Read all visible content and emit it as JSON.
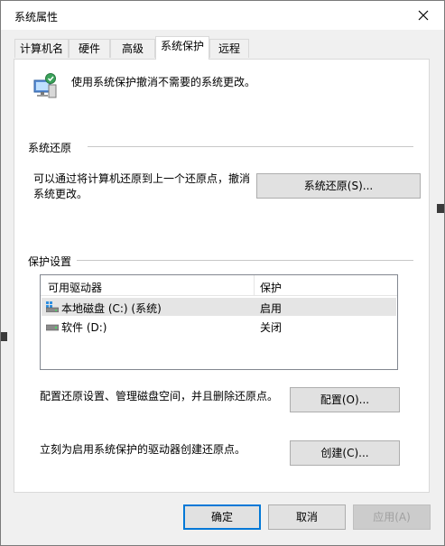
{
  "window": {
    "title": "系统属性"
  },
  "tabs": [
    {
      "label": "计算机名"
    },
    {
      "label": "硬件"
    },
    {
      "label": "高级"
    },
    {
      "label": "系统保护"
    },
    {
      "label": "远程"
    }
  ],
  "active_tab": "系统保护",
  "header": {
    "description": "使用系统保护撤消不需要的系统更改。",
    "icon": "system-protection-icon"
  },
  "restore": {
    "title": "系统还原",
    "text": "可以通过将计算机还原到上一个还原点，撤消系统更改。",
    "button": "系统还原(S)..."
  },
  "protection": {
    "title": "保护设置",
    "columns": [
      "可用驱动器",
      "保护"
    ],
    "rows": [
      {
        "name": "本地磁盘 (C:) (系统)",
        "protection": "启用",
        "icon": "system-drive-icon",
        "selected": true
      },
      {
        "name": "软件 (D:)",
        "protection": "关闭",
        "icon": "drive-icon",
        "selected": false
      }
    ],
    "configure_text": "配置还原设置、管理磁盘空间，并且删除还原点。",
    "configure_button": "配置(O)...",
    "create_text": "立刻为启用系统保护的驱动器创建还原点。",
    "create_button": "创建(C)..."
  },
  "footer": {
    "ok": "确定",
    "cancel": "取消",
    "apply": "应用(A)"
  },
  "colors": {
    "accent": "#0078d7",
    "selected_row": "#e5e5e5"
  }
}
